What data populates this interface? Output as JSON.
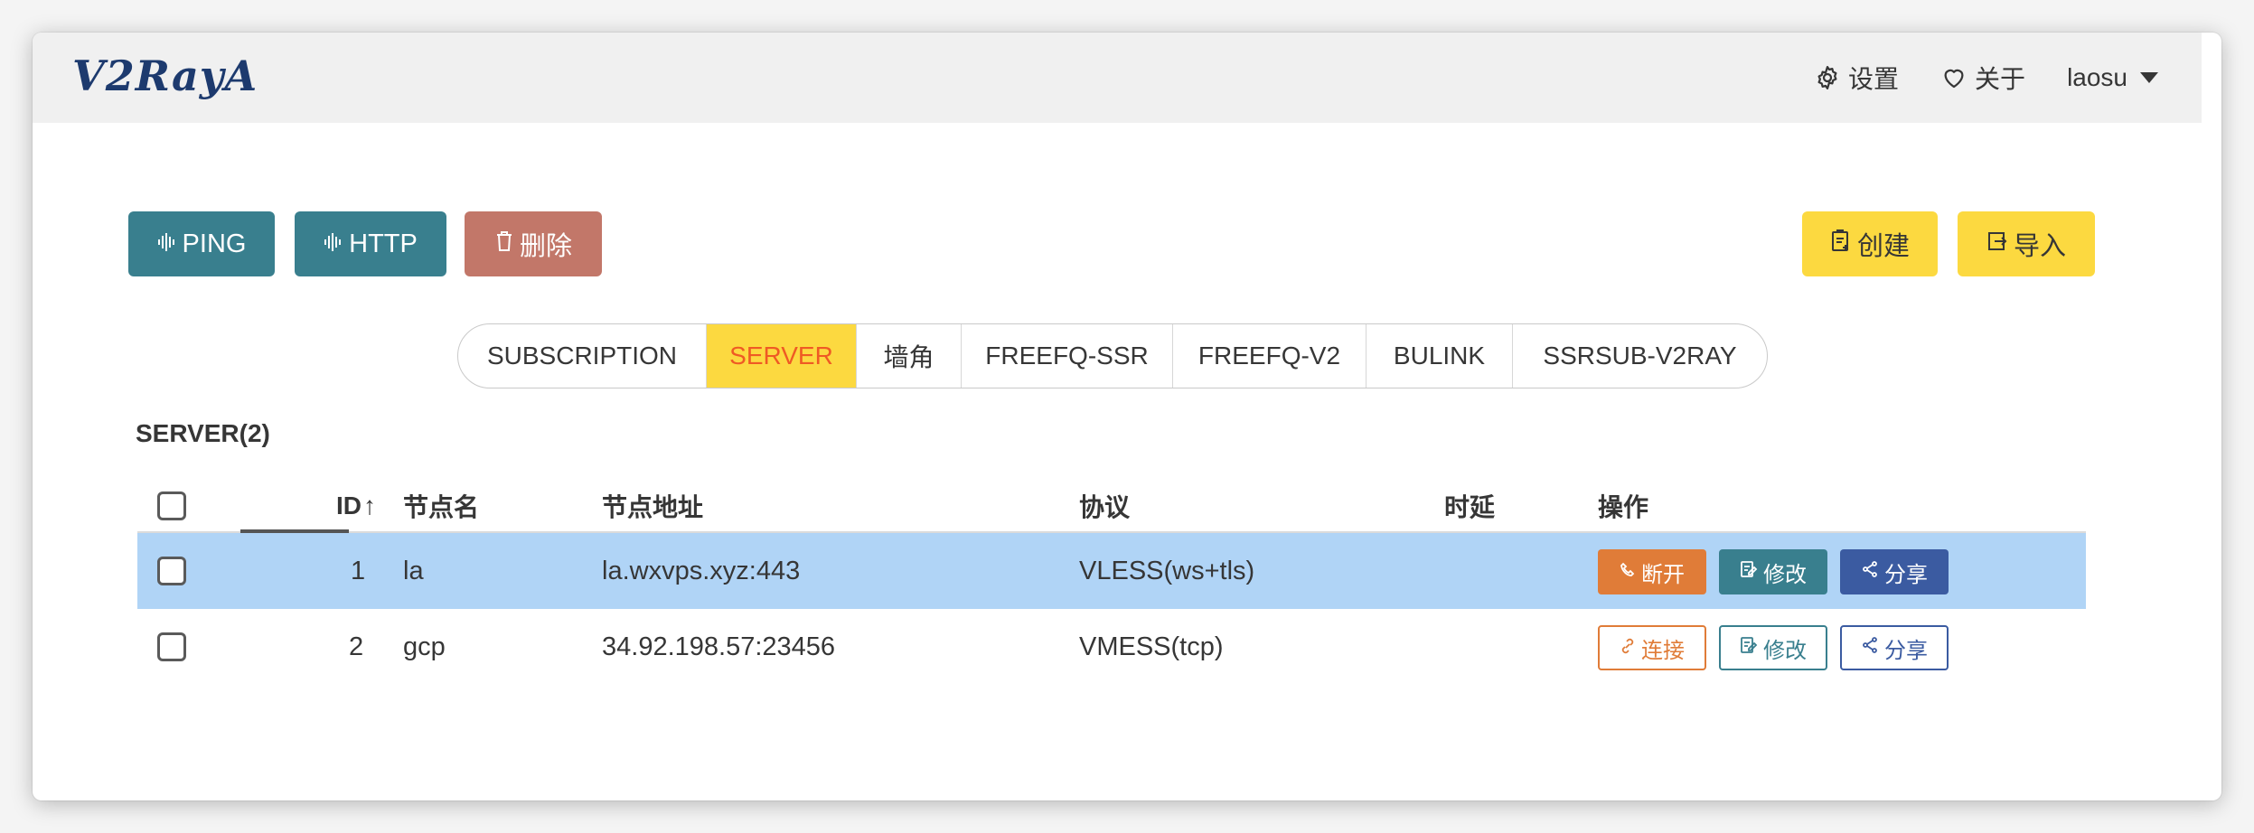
{
  "app": {
    "logo_text": "V2RayA"
  },
  "nav": {
    "settings_label": "设置",
    "about_label": "关于",
    "user_label": "laosu"
  },
  "toolbar": {
    "ping_label": "PING",
    "http_label": "HTTP",
    "delete_label": "删除",
    "create_label": "创建",
    "import_label": "导入"
  },
  "tabs": [
    {
      "label": "SUBSCRIPTION",
      "active": false
    },
    {
      "label": "SERVER",
      "active": true
    },
    {
      "label": "墙角",
      "active": false
    },
    {
      "label": "FREEFQ-SSR",
      "active": false
    },
    {
      "label": "FREEFQ-V2",
      "active": false
    },
    {
      "label": "BULINK",
      "active": false
    },
    {
      "label": "SSRSUB-V2RAY",
      "active": false
    }
  ],
  "section_title": "SERVER(2)",
  "table": {
    "headers": {
      "id": "ID",
      "id_sort_indicator": "↑",
      "name": "节点名",
      "address": "节点地址",
      "protocol": "协议",
      "latency": "时延",
      "actions": "操作"
    },
    "rows": [
      {
        "id": "1",
        "name": "la",
        "address": "la.wxvps.xyz:443",
        "protocol": "VLESS(ws+tls)",
        "latency": "",
        "selected": true,
        "connect_label": "断开",
        "edit_label": "修改",
        "share_label": "分享"
      },
      {
        "id": "2",
        "name": "gcp",
        "address": "34.92.198.57:23456",
        "protocol": "VMESS(tcp)",
        "latency": "",
        "selected": false,
        "connect_label": "连接",
        "edit_label": "修改",
        "share_label": "分享"
      }
    ]
  },
  "colors": {
    "teal": "#397f8e",
    "red": "#c27769",
    "yellow": "#fcd940",
    "orange": "#e07c38",
    "blue": "#3b5ba1",
    "selected_row": "#b0d4f6",
    "active_tab_text": "#ef5a24"
  }
}
